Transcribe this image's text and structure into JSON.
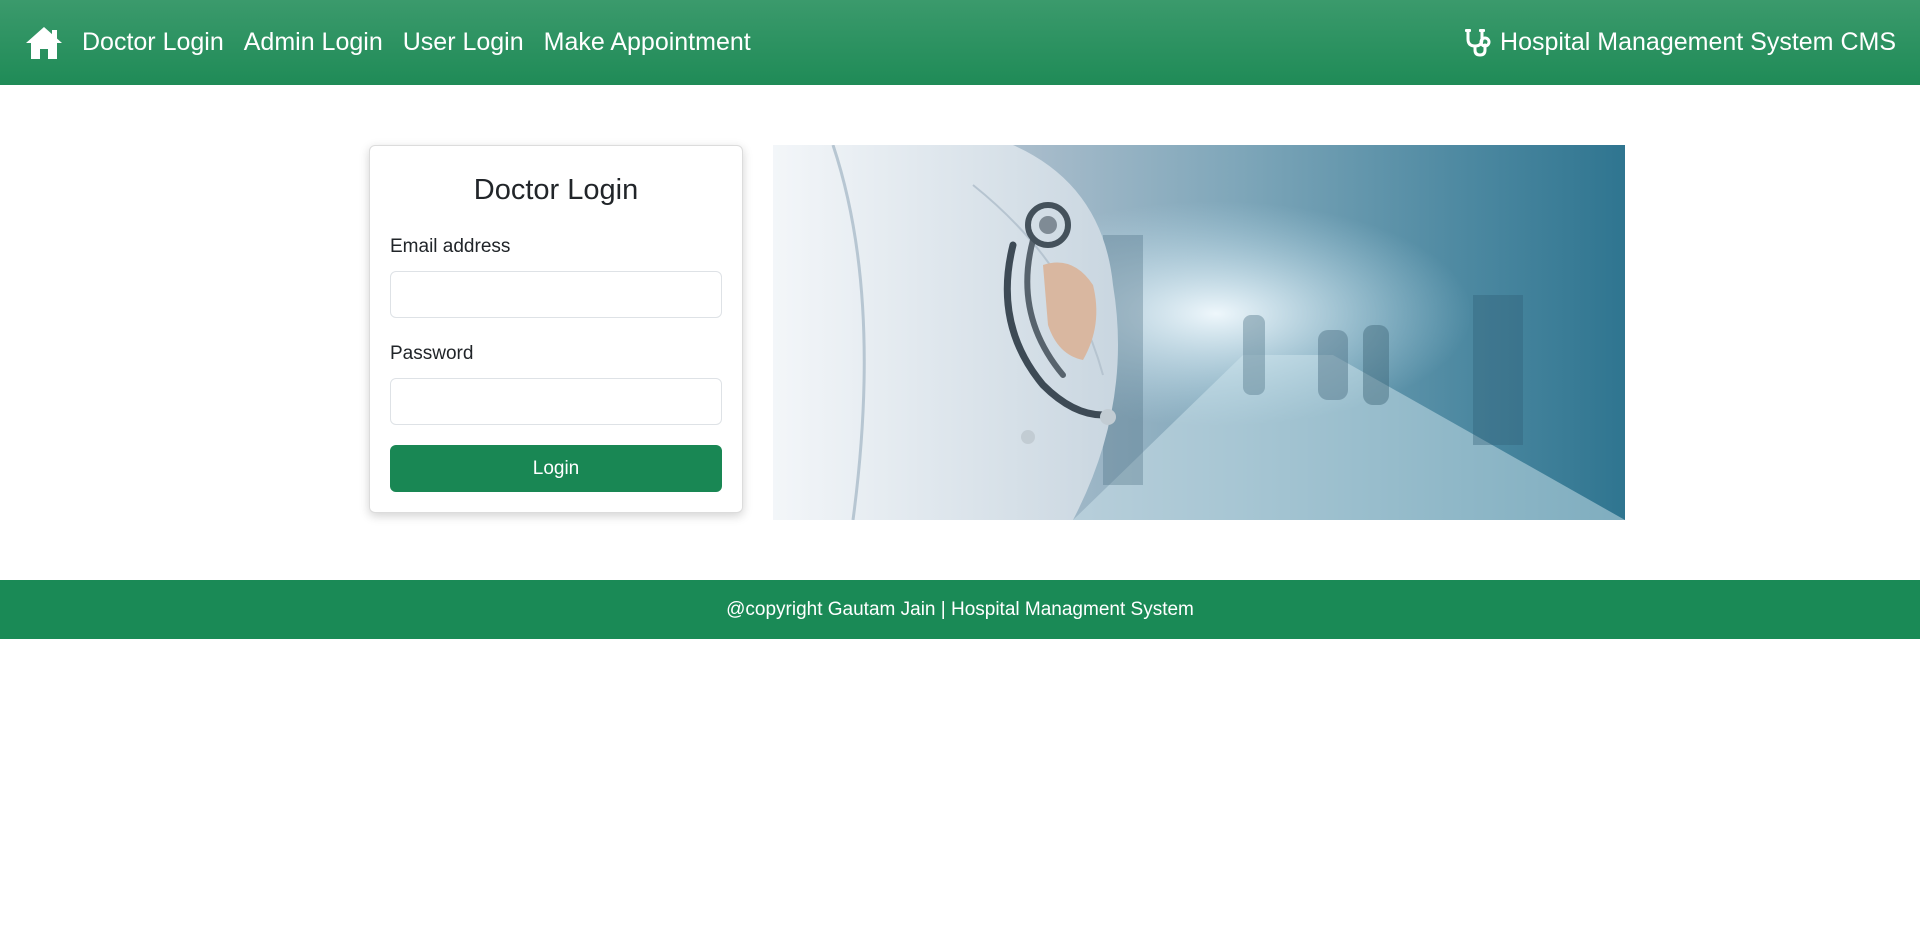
{
  "navbar": {
    "home_icon": "home-icon",
    "links": [
      {
        "label": "Doctor Login"
      },
      {
        "label": "Admin Login"
      },
      {
        "label": "User Login"
      },
      {
        "label": "Make Appointment"
      }
    ],
    "brand_icon": "stethoscope-icon",
    "brand_label": "Hospital Management System CMS"
  },
  "login_card": {
    "title": "Doctor Login",
    "email_label": "Email address",
    "email_value": "",
    "password_label": "Password",
    "password_value": "",
    "submit_label": "Login"
  },
  "hero": {
    "image": "doctor-with-stethoscope-hospital-corridor"
  },
  "footer": {
    "text": "@copyright Gautam Jain | Hospital Managment System"
  },
  "colors": {
    "primary": "#198754",
    "navbar_top": "#3b9a6c",
    "navbar_bottom": "#1f8b57",
    "text": "#212529"
  }
}
